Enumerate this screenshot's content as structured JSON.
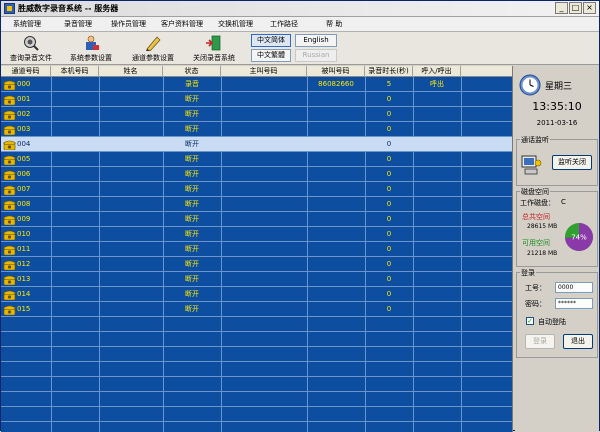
{
  "window": {
    "title": "胜威数字录音系统 -- 服务器",
    "controls": [
      "_",
      "□",
      "×"
    ]
  },
  "menu": [
    "系统管理",
    "录音管理",
    "操作员管理",
    "客户资料管理",
    "交换机管理",
    "工作路径",
    "帮 助"
  ],
  "toolbar": {
    "buttons": [
      {
        "label": "查询录音文件",
        "icon": "search-tape-icon"
      },
      {
        "label": "系统参数设置",
        "icon": "settings-person-icon"
      },
      {
        "label": "通道参数设置",
        "icon": "pen-tool-icon"
      },
      {
        "label": "关闭录音系统",
        "icon": "exit-door-icon"
      }
    ],
    "languages": {
      "simplified": "中文简体",
      "traditional": "中文繁體",
      "english": "English",
      "disabled": "Russian"
    }
  },
  "table": {
    "columns": [
      "通道号码",
      "本机号码",
      "姓名",
      "状态",
      "主叫号码",
      "被叫号码",
      "录音时长(秒)",
      "呼入/呼出"
    ],
    "rows": [
      {
        "channel": "000",
        "status": "录音",
        "caller": "",
        "called": "86082660",
        "duration": "5",
        "direction": "呼出",
        "selected": false
      },
      {
        "channel": "001",
        "status": "断开",
        "caller": "",
        "called": "",
        "duration": "0",
        "direction": "",
        "selected": false
      },
      {
        "channel": "002",
        "status": "断开",
        "caller": "",
        "called": "",
        "duration": "0",
        "direction": "",
        "selected": false
      },
      {
        "channel": "003",
        "status": "断开",
        "caller": "",
        "called": "",
        "duration": "0",
        "direction": "",
        "selected": false
      },
      {
        "channel": "004",
        "status": "断开",
        "caller": "",
        "called": "",
        "duration": "0",
        "direction": "",
        "selected": true
      },
      {
        "channel": "005",
        "status": "断开",
        "caller": "",
        "called": "",
        "duration": "0",
        "direction": "",
        "selected": false
      },
      {
        "channel": "006",
        "status": "断开",
        "caller": "",
        "called": "",
        "duration": "0",
        "direction": "",
        "selected": false
      },
      {
        "channel": "007",
        "status": "断开",
        "caller": "",
        "called": "",
        "duration": "0",
        "direction": "",
        "selected": false
      },
      {
        "channel": "008",
        "status": "断开",
        "caller": "",
        "called": "",
        "duration": "0",
        "direction": "",
        "selected": false
      },
      {
        "channel": "009",
        "status": "断开",
        "caller": "",
        "called": "",
        "duration": "0",
        "direction": "",
        "selected": false
      },
      {
        "channel": "010",
        "status": "断开",
        "caller": "",
        "called": "",
        "duration": "0",
        "direction": "",
        "selected": false
      },
      {
        "channel": "011",
        "status": "断开",
        "caller": "",
        "called": "",
        "duration": "0",
        "direction": "",
        "selected": false
      },
      {
        "channel": "012",
        "status": "断开",
        "caller": "",
        "called": "",
        "duration": "0",
        "direction": "",
        "selected": false
      },
      {
        "channel": "013",
        "status": "断开",
        "caller": "",
        "called": "",
        "duration": "0",
        "direction": "",
        "selected": false
      },
      {
        "channel": "014",
        "status": "断开",
        "caller": "",
        "called": "",
        "duration": "0",
        "direction": "",
        "selected": false
      },
      {
        "channel": "015",
        "status": "断开",
        "caller": "",
        "called": "",
        "duration": "0",
        "direction": "",
        "selected": false
      }
    ]
  },
  "side": {
    "weekday": "星期三",
    "time": "13:35:10",
    "date": "2011-03-16",
    "monitor": {
      "title": "通话监听",
      "button": "监听关闭"
    },
    "disk": {
      "title": "磁盘空间",
      "work_disk_label": "工作磁盘：",
      "work_disk_value": "C",
      "total_label": "总共空间",
      "total_value": "28615 MB",
      "free_label": "可用空间",
      "free_value": "21218 MB",
      "used_percent": 74,
      "used_percent_text": "74%"
    },
    "login": {
      "title": "登录",
      "id_label": "工号：",
      "id_value": "0000",
      "pwd_label": "密码：",
      "pwd_value": "******",
      "auto_login": "自动登陆",
      "auto_checked": true,
      "login_button": "登录",
      "exit_button": "退出"
    }
  },
  "colors": {
    "grid_bg": "#0d4ea1",
    "grid_text": "#ffe800",
    "selected_row": "#c9dcf4"
  }
}
